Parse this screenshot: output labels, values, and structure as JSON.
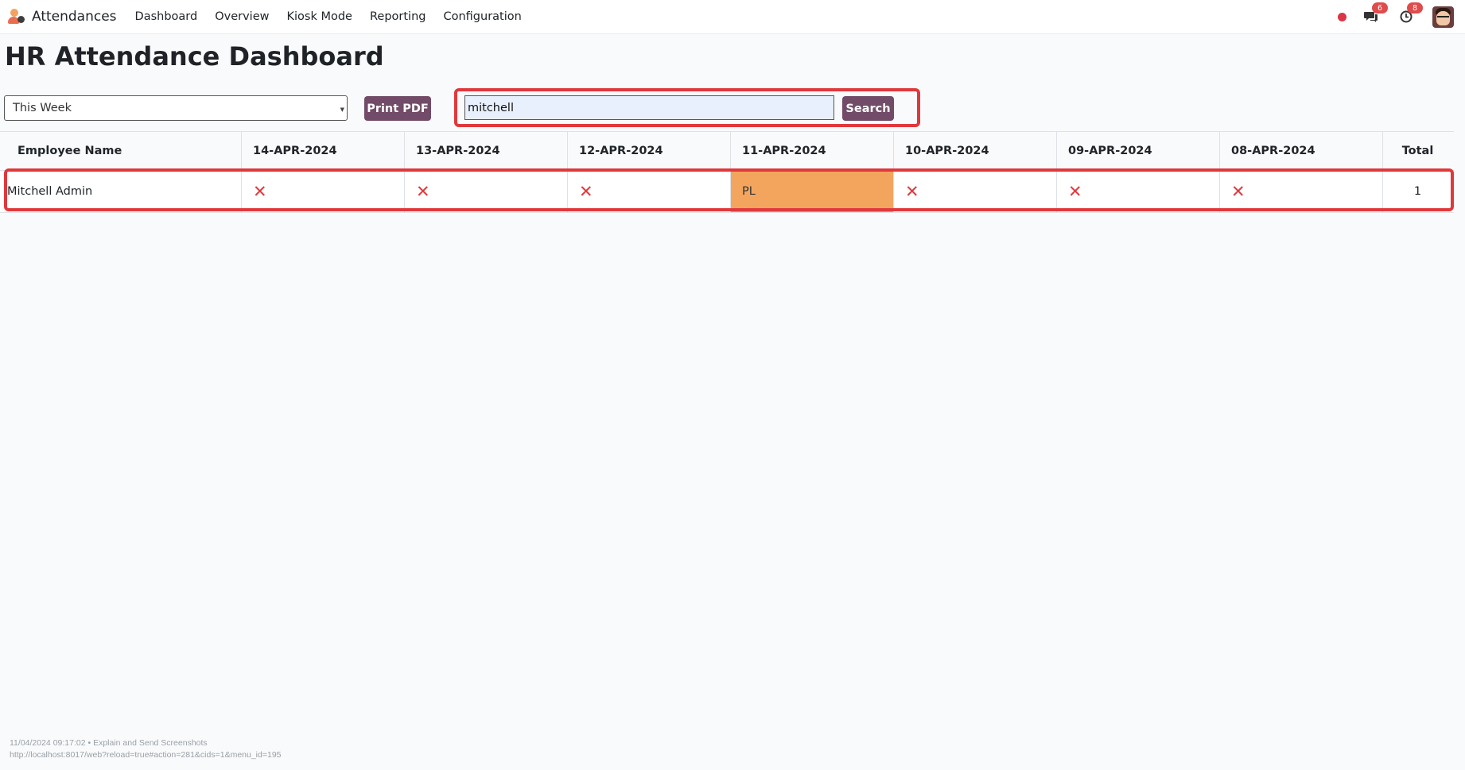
{
  "nav": {
    "app_name": "Attendances",
    "items": [
      "Dashboard",
      "Overview",
      "Kiosk Mode",
      "Reporting",
      "Configuration"
    ],
    "messages_badge": "6",
    "activities_badge": "8"
  },
  "page": {
    "title": "HR Attendance Dashboard"
  },
  "controls": {
    "period_selected": "This Week",
    "print_label": "Print PDF",
    "search_value": "mitchell",
    "search_label": "Search"
  },
  "table": {
    "headers": [
      "Employee Name",
      "14-APR-2024",
      "13-APR-2024",
      "12-APR-2024",
      "11-APR-2024",
      "10-APR-2024",
      "09-APR-2024",
      "08-APR-2024",
      "Total"
    ],
    "rows": [
      {
        "name": "Mitchell Admin",
        "days": [
          "✕",
          "✕",
          "✕",
          "PL",
          "✕",
          "✕",
          "✕"
        ],
        "total": "1"
      }
    ]
  },
  "footer": {
    "line1": "11/04/2024 09:17:02 • Explain and Send Screenshots",
    "line2": "http://localhost:8017/web?reload=true#action=281&cids=1&menu_id=195"
  },
  "colors": {
    "primary": "#714b67",
    "highlight": "#e0383b",
    "leave": "#f3a55e",
    "absent": "#e0383b"
  }
}
